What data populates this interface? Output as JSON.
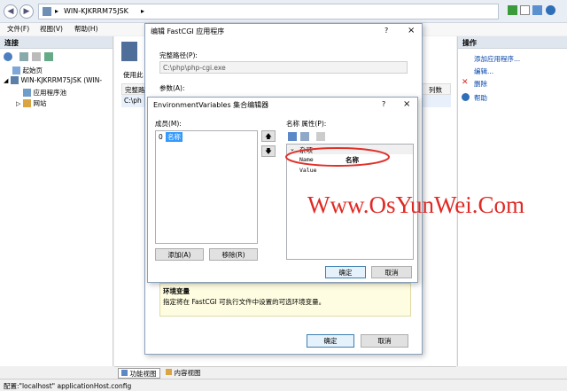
{
  "address": {
    "path": "WIN-KJKRRM75JSK"
  },
  "menu": [
    "文件(F)",
    "视图(V)",
    "帮助(H)"
  ],
  "left": {
    "title": "连接",
    "tree": {
      "root": "起始页",
      "server": "WIN-KJKRRM75JSK (WIN-",
      "pools": "应用程序池",
      "sites": "网站"
    }
  },
  "center": {
    "fragment_use": "使用此",
    "fragment_path": "完整路",
    "fragment_cphp": "C:\\ph",
    "fragment_count": "列数"
  },
  "right": {
    "title": "操作",
    "actions": [
      "添加应用程序...",
      "编辑...",
      "删除",
      "帮助"
    ]
  },
  "fastcgi": {
    "title": "编辑 FastCGI 应用程序",
    "help_glyph": "?",
    "close_glyph": "×",
    "fullpath_label": "完整路径(P):",
    "fullpath_value": "C:\\php\\php-cgi.exe",
    "args_label": "参数(A):",
    "desc_title": "环境变量",
    "desc_text": "指定将在 FastCGI 可执行文件中设置的可选环境变量。",
    "ok": "确定",
    "cancel": "取消"
  },
  "envdialog": {
    "title": "EnvironmentVariables 集合编辑器",
    "help_glyph": "?",
    "close_glyph": "×",
    "members_label": "成员(M):",
    "member_index": "0",
    "member_name": "名称",
    "props_label": "名称 属性(P):",
    "group": "杂项",
    "prop_name_label": "Name",
    "prop_name_value": "名称",
    "prop_value_label": "Value",
    "add": "添加(A)",
    "remove": "移除(R)",
    "ok": "确定",
    "cancel": "取消",
    "annotation_color": "#e0302a"
  },
  "watermark": {
    "text": "Www.OsYunWei.Com",
    "color": "#e02a25"
  },
  "bottom": {
    "feature_view": "功能视图",
    "content_view": "内容视图"
  },
  "status": "配置:\"localhost\" applicationHost.config"
}
